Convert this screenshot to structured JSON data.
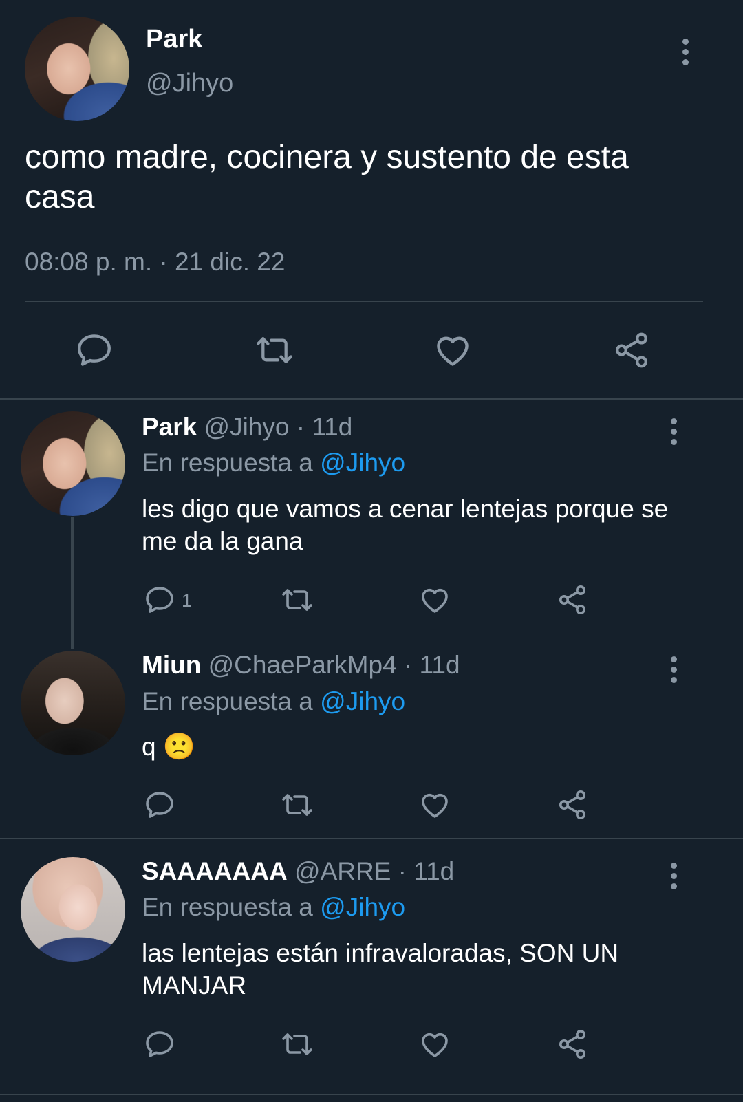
{
  "main_tweet": {
    "name": "Park",
    "handle": "@Jihyo",
    "text": "como madre, cocinera y sustento de esta casa",
    "timestamp": "08:08 p. m. · 21 dic. 22"
  },
  "replies": [
    {
      "name": "Park",
      "handle": "@Jihyo",
      "time": "· 11d",
      "reply_prefix": "En respuesta a",
      "reply_to": "@Jihyo",
      "text": "les digo que vamos a cenar lentejas porque se me da la gana",
      "reply_count": "1"
    },
    {
      "name": "Miun",
      "handle": "@ChaeParkMp4",
      "time": "· 11d",
      "reply_prefix": "En respuesta a",
      "reply_to": "@Jihyo",
      "text": "q",
      "emoji": "🙁"
    },
    {
      "name": "SAAAAAAA",
      "handle": "@ARRE",
      "time": "· 11d",
      "reply_prefix": "En respuesta a",
      "reply_to": "@Jihyo",
      "text": "las lentejas están infravaloradas, SON UN MANJAR"
    }
  ],
  "icons": {
    "reply": "reply-icon",
    "retweet": "retweet-icon",
    "like": "heart-icon",
    "share": "share-icon",
    "more": "more-vertical-icon"
  },
  "colors": {
    "background": "#15202b",
    "text": "#ffffff",
    "muted": "#8b98a5",
    "link": "#1d9bf0",
    "divider": "#38444d"
  }
}
